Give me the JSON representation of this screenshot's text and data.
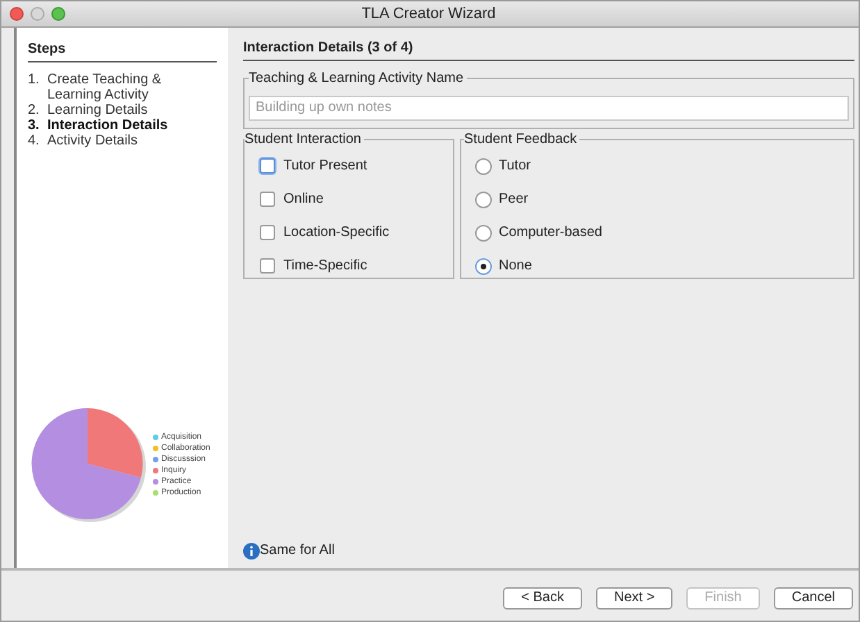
{
  "window": {
    "title": "TLA Creator Wizard"
  },
  "steps": {
    "title": "Steps",
    "items": [
      {
        "number": "1.",
        "label": "Create Teaching & Learning Activity",
        "selected": false
      },
      {
        "number": "2.",
        "label": "Learning Details",
        "selected": false
      },
      {
        "number": "3.",
        "label": "Interaction Details",
        "selected": true
      },
      {
        "number": "4.",
        "label": "Activity Details",
        "selected": false
      }
    ]
  },
  "legend": [
    {
      "label": "Acquisition",
      "color": "#5fcfe0"
    },
    {
      "label": "Collaboration",
      "color": "#f0c020"
    },
    {
      "label": "Discusssion",
      "color": "#6fa0e8"
    },
    {
      "label": "Inquiry",
      "color": "#f07878"
    },
    {
      "label": "Practice",
      "color": "#b48ee0"
    },
    {
      "label": "Production",
      "color": "#a8e070"
    }
  ],
  "page_title": "Interaction Details (3 of 4)",
  "name_group": {
    "title": "Teaching & Learning Activity Name",
    "placeholder": "Building up own notes"
  },
  "student_interaction": {
    "title": "Student Interaction",
    "options": [
      {
        "label": "Tutor Present",
        "checked": false,
        "focused": true
      },
      {
        "label": "Online",
        "checked": false,
        "focused": false
      },
      {
        "label": "Location-Specific",
        "checked": false,
        "focused": false
      },
      {
        "label": "Time-Specific",
        "checked": false,
        "focused": false
      }
    ]
  },
  "student_feedback": {
    "title": "Student Feedback",
    "options": [
      {
        "label": "Tutor",
        "selected": false
      },
      {
        "label": "Peer",
        "selected": false
      },
      {
        "label": "Computer-based",
        "selected": false
      },
      {
        "label": "None",
        "selected": true
      }
    ]
  },
  "info": "Same for All",
  "buttons": [
    {
      "label": "< Back",
      "disabled": false
    },
    {
      "label": "Next >",
      "disabled": false
    },
    {
      "label": "Finish",
      "disabled": true
    },
    {
      "label": "Cancel",
      "disabled": false
    }
  ]
}
